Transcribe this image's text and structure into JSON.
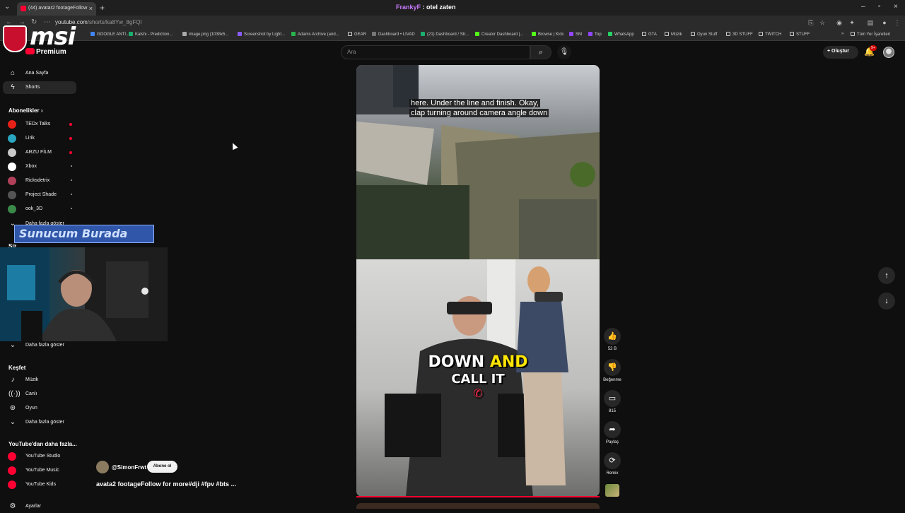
{
  "browser": {
    "tab_title": "(44) avatar2 footageFollow",
    "center_title_user": "FrankyF",
    "center_title_text": ": otel zaten",
    "url_host": "youtube.com",
    "url_path": "/shorts/ka8Yw_8gFQI",
    "bookmarks": [
      "GOOGLE ANTI...",
      "Kalshi - Prediction...",
      "image.png (1038x5...",
      "Screenshot by Light...",
      "Adams Archive (and...",
      "GEAR",
      "Dashboard • LIVAD",
      "(21) Dashboard / Str...",
      "Creator Dashboard |...",
      "Browse | Kick",
      "SM",
      "Top",
      "WhatsApp",
      "GTA",
      "Müzik",
      "Oyun Stuff",
      "3D STUFF",
      "TWITCH",
      "STUFF",
      "Tüm Yer İşaretleri"
    ]
  },
  "overlay": {
    "brand": "msi",
    "banner_text": "Sunucum Burada"
  },
  "header": {
    "logo_text": "Premium",
    "search_placeholder": "Ara",
    "create_label": "Oluştur",
    "notif_badge": "9+"
  },
  "sidebar": {
    "home": "Ana Sayfa",
    "shorts": "Shorts",
    "subs_heading": "Abonelikler",
    "subs": [
      {
        "name": "TEDx Talks",
        "color": "#e62117",
        "live": true
      },
      {
        "name": "Lirik",
        "color": "#2aa6c0",
        "live": true
      },
      {
        "name": "ARZU FİLM",
        "color": "#c9c9c9",
        "live": true
      },
      {
        "name": "Xbox",
        "color": "#ffffff",
        "live": false
      },
      {
        "name": "Ricksdetrix",
        "color": "#b0405a",
        "live": false
      },
      {
        "name": "Project Shade",
        "color": "#555555",
        "live": false
      },
      {
        "name": "ook_3D",
        "color": "#3a8a4a",
        "live": false
      }
    ],
    "show_more_top": "Daha fazla göster",
    "siz_heading": "Siz",
    "show_more_2": "Daha fazla göster",
    "explore_heading": "Keşfet",
    "explore": [
      "Müzik",
      "Canlı",
      "Oyun"
    ],
    "show_more_3": "Daha fazla göster",
    "more_heading": "YouTube'dan daha fazla...",
    "more": [
      "YouTube Studio",
      "YouTube Music",
      "YouTube Kids"
    ],
    "settings": "Ayarlar"
  },
  "video": {
    "caption_line1": "here. Under the line and finish. Okay,",
    "caption_line2": "clap turning around camera angle down",
    "subtitle_word1": "DOWN",
    "subtitle_word2": "AND",
    "subtitle_line2": "CALL IT",
    "channel": "@SimonFrwt",
    "subscribe_label": "Abone ol",
    "title": "avata2 footageFollow for more#dji #fpv #bts ...",
    "likes": "52 B",
    "dislike_label": "Beğenme",
    "comments": "815",
    "share_label": "Paylaş",
    "remix_label": "Remix"
  }
}
